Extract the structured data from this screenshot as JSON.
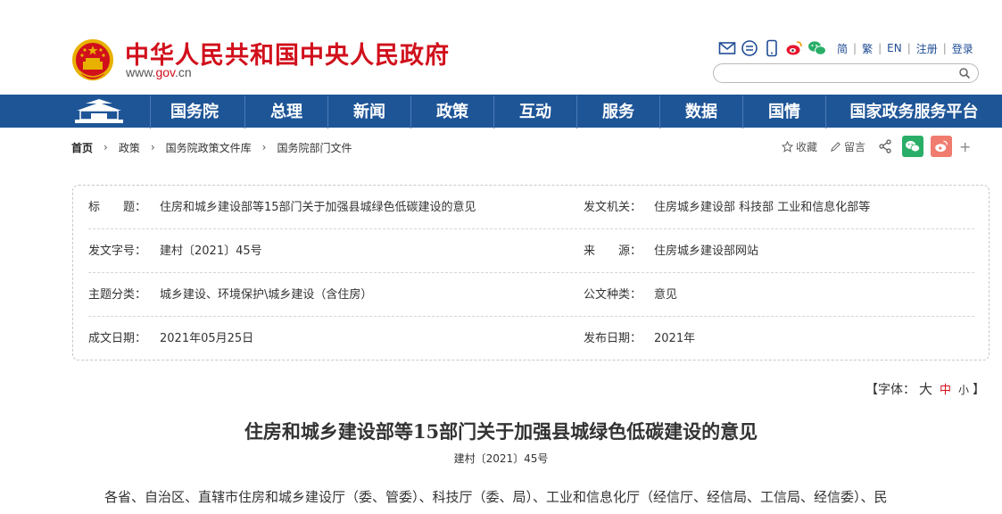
{
  "header": {
    "site_title": "中华人民共和国中央人民政府",
    "domain_prefix": "www.",
    "domain_main": "gov",
    "domain_suffix": ".cn",
    "toolbar_icons": [
      "mail-icon",
      "message-icon",
      "mobile-icon",
      "weibo-icon",
      "wechat-icon"
    ],
    "languages": [
      "简",
      "繁",
      "EN"
    ],
    "account_links": [
      "注册",
      "登录"
    ],
    "search_placeholder": ""
  },
  "nav": {
    "items": [
      "国务院",
      "总理",
      "新闻",
      "政策",
      "互动",
      "服务",
      "数据",
      "国情",
      "国家政务服务平台"
    ]
  },
  "breadcrumb": {
    "items": [
      "首页",
      "政策",
      "国务院政策文件库",
      "国务院部门文件"
    ]
  },
  "tools": {
    "favorite": "收藏",
    "comment": "留言"
  },
  "info": {
    "rows": [
      {
        "l1": "标　　题：",
        "v1": "住房和城乡建设部等15部门关于加强县城绿色低碳建设的意见",
        "l2": "发文机关：",
        "v2": "住房城乡建设部 科技部 工业和信息化部等"
      },
      {
        "l1": "发文字号：",
        "v1": "建村〔2021〕45号",
        "l2": "来　　源：",
        "v2": "住房城乡建设部网站"
      },
      {
        "l1": "主题分类：",
        "v1": "城乡建设、环境保护\\城乡建设（含住房）",
        "l2": "公文种类：",
        "v2": "意见"
      },
      {
        "l1": "成文日期：",
        "v1": "2021年05月25日",
        "l2": "发布日期：",
        "v2": "2021年"
      }
    ]
  },
  "fontsize": {
    "prefix": "【字体：",
    "big": "大",
    "mid": "中",
    "small": "小",
    "suffix": "】"
  },
  "article": {
    "title": "住房和城乡建设部等15部门关于加强县城绿色低碳建设的意见",
    "doc_no": "建村〔2021〕45号",
    "body_first_line": "各省、自治区、直辖市住房和城乡建设厅（委、管委）、科技厅（委、局）、工业和信息化厅（经信厅、经信局、工信局、经信委）、民"
  },
  "colors": {
    "brand_red": "#d1101c",
    "nav_blue": "#1e5597",
    "link_blue": "#1f4c95",
    "wechat_green": "#2aae67",
    "weibo_red": "#f07b6f"
  }
}
